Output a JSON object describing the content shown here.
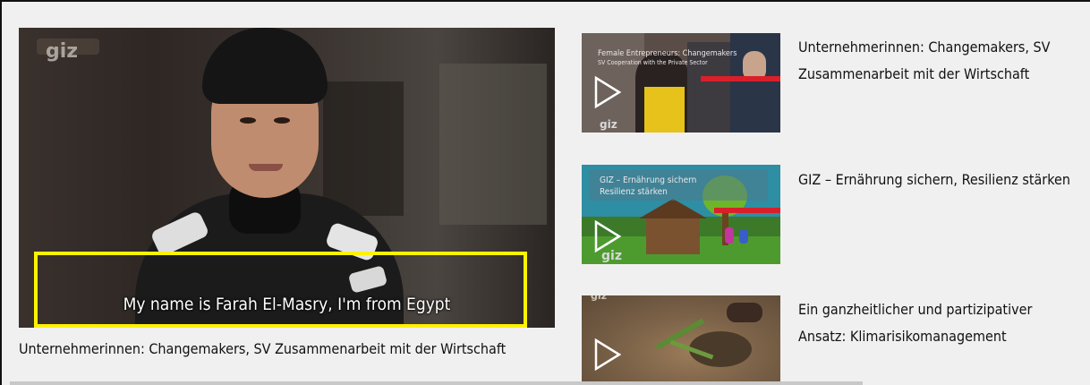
{
  "main_video": {
    "logo": "giz",
    "subtitle": "My name is Farah El-Masry, I'm from Egypt",
    "caption": "Unternehmerinnen: Changemakers, SV Zusammenarbeit mit der Wirtschaft"
  },
  "playlist": [
    {
      "thumb_caption_line1": "Female Entrepreneurs: Changemakers",
      "thumb_caption_line2": "SV Cooperation with the Private Sector",
      "logo": "giz",
      "title": "Unternehmerinnen: Changemakers, SV Zusammenarbeit mit der Wirtschaft"
    },
    {
      "thumb_caption_line1": "GIZ – Ernährung sichern",
      "thumb_caption_line2": "Resilienz stärken",
      "logo": "giz",
      "title": "GIZ – Ernährung sichern, Resilienz stärken"
    },
    {
      "logo": "giz",
      "title": "Ein ganzheitlicher und partizipativer Ansatz: Klimarisikomanagement"
    }
  ],
  "colors": {
    "highlight": "#fff200",
    "accent_red": "#d9202a"
  },
  "icons": {
    "play": "play-triangle-outline"
  }
}
